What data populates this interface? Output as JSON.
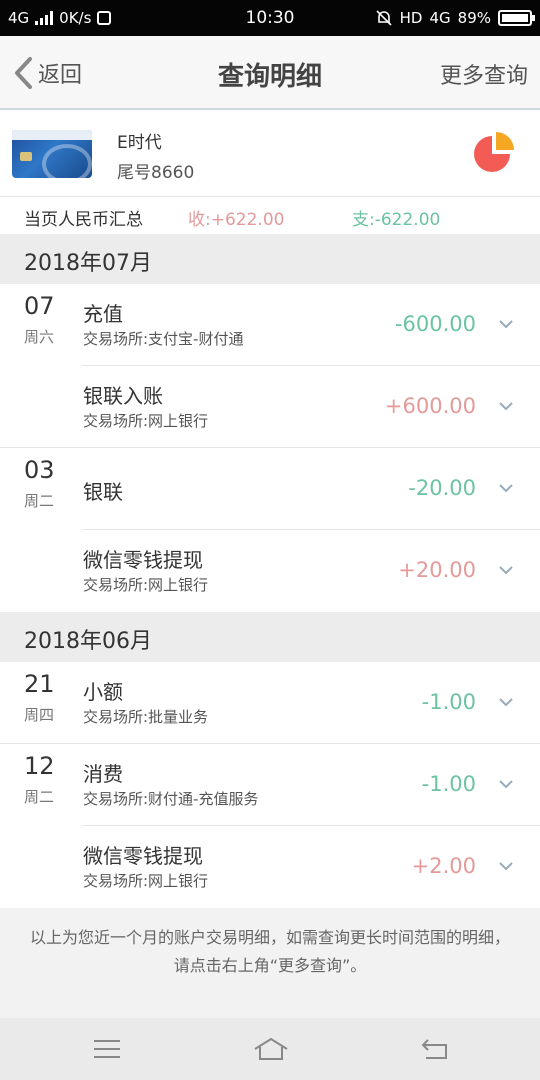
{
  "status": {
    "network": "4G",
    "speed": "0K/s",
    "time": "10:30",
    "hd": "HD",
    "network2": "4G",
    "battery": "89%",
    "battery_level": 0.89
  },
  "header": {
    "back_label": "返回",
    "title": "查询明细",
    "more_label": "更多查询"
  },
  "card": {
    "name": "E时代",
    "tail": "尾号8660"
  },
  "summary": {
    "label": "当页人民币汇总",
    "income": "收:+622.00",
    "expense": "支:-622.00"
  },
  "months": [
    {
      "label": "2018年07月",
      "groups": [
        {
          "day": "07",
          "weekday": "周六",
          "items": [
            {
              "name": "充值",
              "place": "交易场所:支付宝-财付通",
              "amount": "-600.00",
              "sign": "neg"
            },
            {
              "name": "银联入账",
              "place": "交易场所:网上银行",
              "amount": "+600.00",
              "sign": "pos"
            }
          ]
        },
        {
          "day": "03",
          "weekday": "周二",
          "items": [
            {
              "name": "银联",
              "place": "",
              "amount": "-20.00",
              "sign": "neg"
            },
            {
              "name": "微信零钱提现",
              "place": "交易场所:网上银行",
              "amount": "+20.00",
              "sign": "pos"
            }
          ]
        }
      ]
    },
    {
      "label": "2018年06月",
      "groups": [
        {
          "day": "21",
          "weekday": "周四",
          "items": [
            {
              "name": "小额",
              "place": "交易场所:批量业务",
              "amount": "-1.00",
              "sign": "neg"
            }
          ]
        },
        {
          "day": "12",
          "weekday": "周二",
          "items": [
            {
              "name": "消费",
              "place": "交易场所:财付通-充值服务",
              "amount": "-1.00",
              "sign": "neg"
            },
            {
              "name": "微信零钱提现",
              "place": "交易场所:网上银行",
              "amount": "+2.00",
              "sign": "pos"
            }
          ]
        }
      ]
    }
  ],
  "footer": {
    "line1": "以上为您近一个月的账户交易明细，如需查询更长时间范围的明细，",
    "line2": "请点击右上角“更多查询”。"
  },
  "colors": {
    "income": "#e49a9a",
    "expense": "#6cc3a0",
    "pie_main": "#f25c54",
    "pie_slice": "#f5a623"
  }
}
